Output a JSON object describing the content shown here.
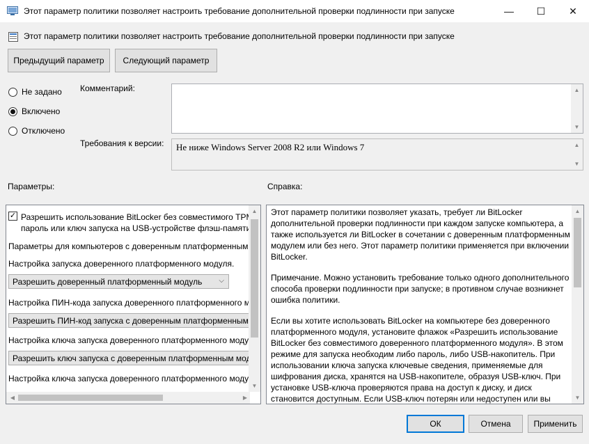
{
  "window": {
    "title": "Этот параметр политики позволяет настроить требование дополнительной проверки подлинности при запуске",
    "minimize_glyph": "—",
    "maximize_glyph": "☐",
    "close_glyph": "✕"
  },
  "header": {
    "policy_title": "Этот параметр политики позволяет настроить требование дополнительной проверки подлинности при запуске"
  },
  "nav": {
    "prev_label": "Предыдущий параметр",
    "next_label": "Следующий параметр"
  },
  "state": {
    "options": [
      {
        "label": "Не задано",
        "selected": false
      },
      {
        "label": "Включено",
        "selected": true
      },
      {
        "label": "Отключено",
        "selected": false
      }
    ]
  },
  "comment": {
    "label": "Комментарий:",
    "value": ""
  },
  "supported": {
    "label": "Требования к версии:",
    "value": "Не ниже Windows Server 2008 R2 или Windows 7"
  },
  "options_panel": {
    "heading": "Параметры:",
    "checkbox_line1": "Разрешить использование BitLocker без совместимого TPM",
    "checkbox_line2": "пароль или ключ запуска на USB-устройстве флэш-памяти)",
    "checkbox_checked": true,
    "tpm_computers_label": "Параметры для компьютеров с доверенным платформенным",
    "tpm_startup_label": "Настройка запуска доверенного платформенного модуля.",
    "tpm_startup_value": "Разрешить доверенный платформенный модуль",
    "tpm_pin_label": "Настройка ПИН-кода запуска доверенного платформенного м",
    "tpm_pin_value": "Разрешить ПИН-код запуска с доверенным платформенным",
    "tpm_key_label": "Настройка ключа запуска доверенного платформенного моду",
    "tpm_key_value": "Разрешить ключ запуска с доверенным платформенным мод",
    "tpm_key_pin_label": "Настройка ключа запуска доверенного платформенного моду"
  },
  "help_panel": {
    "heading": "Справка:",
    "paragraphs": [
      "Этот параметр политики позволяет указать, требует ли BitLocker дополнительной проверки подлинности при каждом запуске компьютера, а также используется ли BitLocker в сочетании с доверенным платформенным модулем или без него. Этот параметр политики применяется при включении BitLocker.",
      "Примечание. Можно установить требование только одного дополнительного способа проверки подлинности при запуске; в противном случае возникнет ошибка политики.",
      "Если вы хотите использовать BitLocker на компьютере без доверенного платформенного модуля, установите флажок «Разрешить использование BitLocker без совместимого доверенного платформенного модуля». В этом режиме для запуска необходим либо пароль, либо USB-накопитель. При использовании ключа запуска ключевые сведения, применяемые для шифрования диска, хранятся на USB-накопителе, образуя USB-ключ. При установке USB-ключа проверяются права на доступ к диску, и диск становится доступным. Если USB-ключ потерян или недоступен или вы"
    ]
  },
  "footer": {
    "ok_label": "ОК",
    "cancel_label": "Отмена",
    "apply_label": "Применить"
  }
}
